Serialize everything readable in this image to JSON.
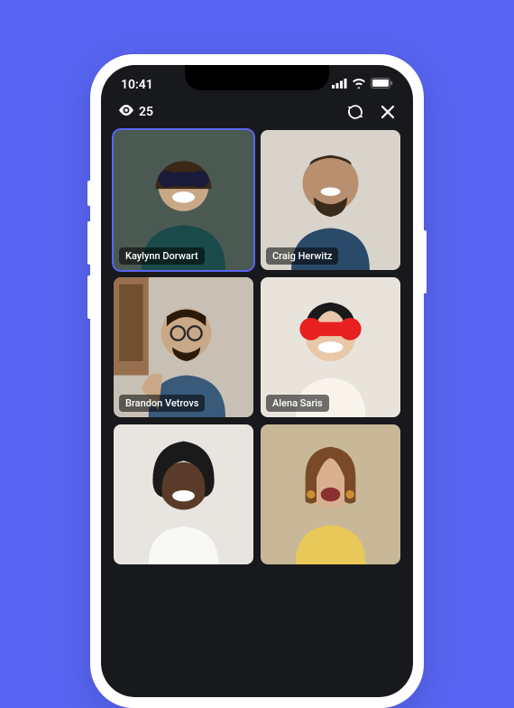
{
  "status_bar": {
    "time": "10:41"
  },
  "header": {
    "viewer_count": "25"
  },
  "participants": [
    {
      "name": "Kaylynn Dorwart",
      "active": true
    },
    {
      "name": "Craig Herwitz",
      "active": false
    },
    {
      "name": "Brandon Vetrovs",
      "active": false
    },
    {
      "name": "Alena Saris",
      "active": false
    },
    {
      "name": "",
      "active": false
    },
    {
      "name": "",
      "active": false
    }
  ]
}
